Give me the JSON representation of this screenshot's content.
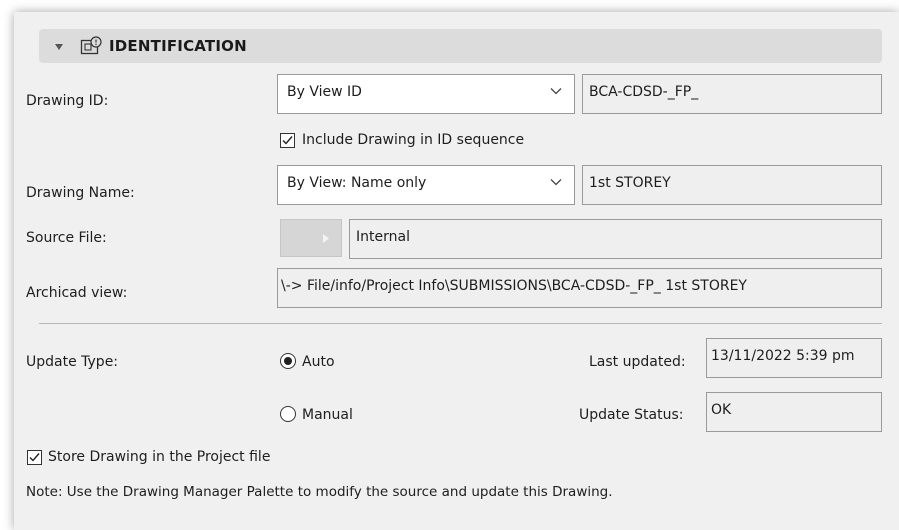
{
  "section": {
    "title": "IDENTIFICATION"
  },
  "drawing_id": {
    "label": "Drawing ID:",
    "select_value": "By View ID",
    "field_value": "BCA-CDSD-_FP_"
  },
  "include_sequence": {
    "label": "Include Drawing in ID sequence",
    "checked": true
  },
  "drawing_name": {
    "label": "Drawing Name:",
    "select_value": "By View: Name only",
    "field_value": "1st STOREY"
  },
  "source_file": {
    "label": "Source File:",
    "field_value": "Internal"
  },
  "archicad_view": {
    "label": "Archicad view:",
    "field_value": "\\-> File/info/Project Info\\SUBMISSIONS\\BCA-CDSD-_FP_ 1st STOREY"
  },
  "update_type": {
    "label": "Update Type:",
    "options": [
      "Auto",
      "Manual"
    ],
    "selected": "Auto"
  },
  "last_updated": {
    "label": "Last updated:",
    "value": "13/11/2022 5:39 pm"
  },
  "update_status": {
    "label": "Update Status:",
    "value": "OK"
  },
  "store_in_project": {
    "label": "Store Drawing in the Project file",
    "checked": true
  },
  "note": "Note: Use the Drawing Manager Palette to modify the source and update this Drawing."
}
